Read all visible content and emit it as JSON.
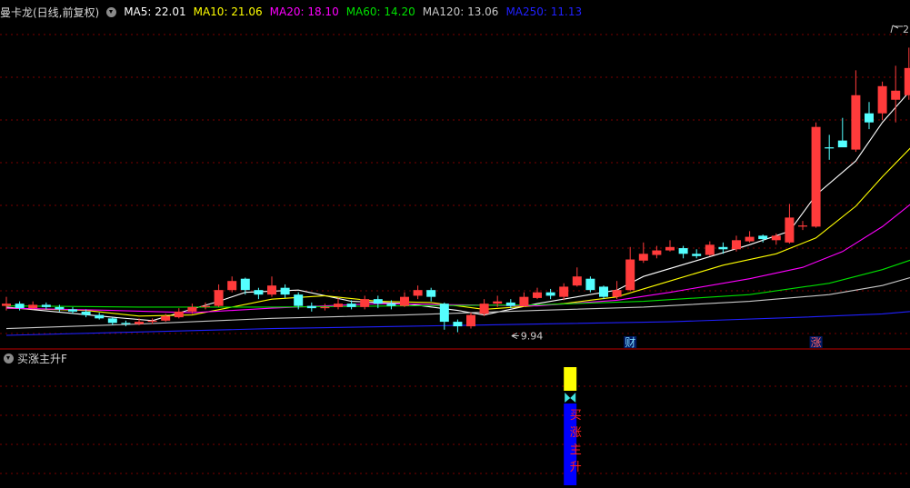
{
  "header": {
    "title": "曼卡龙(日线,前复权)",
    "ma_items": [
      {
        "label": "MA5: 22.01",
        "color": "#ffffff"
      },
      {
        "label": "MA10: 21.06",
        "color": "#ffff00"
      },
      {
        "label": "MA20: 18.10",
        "color": "#ff00ff"
      },
      {
        "label": "MA60: 14.20",
        "color": "#00e000"
      },
      {
        "label": "MA120: 13.06",
        "color": "#c8c8c8"
      },
      {
        "label": "MA250: 11.13",
        "color": "#2020ff"
      }
    ]
  },
  "indicator": {
    "title": "买涨主升F",
    "signal_text": [
      "买",
      "涨",
      "主",
      "升"
    ]
  },
  "markers": {
    "low_label": "9.94",
    "high_label": "2",
    "event_cai": "财",
    "event_zhang": "涨"
  },
  "colors": {
    "up": "#ff3b3b",
    "down": "#54ffff",
    "grid": "#7a0000",
    "signal_yellow": "#ffff00",
    "signal_blue": "#0000ff",
    "signal_text": "#ff2020"
  },
  "chart_data": {
    "type": "candlestick",
    "y_range": [
      9.2,
      23.8
    ],
    "low_marker_candle": 38,
    "candles": [
      [
        11.1,
        11.2,
        11.5,
        10.9
      ],
      [
        11.2,
        11.0,
        11.3,
        10.9
      ],
      [
        11.0,
        11.15,
        11.3,
        10.95
      ],
      [
        11.15,
        11.05,
        11.25,
        10.95
      ],
      [
        11.05,
        10.95,
        11.15,
        10.85
      ],
      [
        10.95,
        10.85,
        11.05,
        10.75
      ],
      [
        10.85,
        10.7,
        10.95,
        10.6
      ],
      [
        10.7,
        10.55,
        10.8,
        10.5
      ],
      [
        10.55,
        10.35,
        10.6,
        10.25
      ],
      [
        10.35,
        10.3,
        10.45,
        10.2
      ],
      [
        10.3,
        10.4,
        10.55,
        10.25
      ],
      [
        10.4,
        10.45,
        10.55,
        10.3
      ],
      [
        10.45,
        10.65,
        10.75,
        10.4
      ],
      [
        10.6,
        10.85,
        11.0,
        10.55
      ],
      [
        10.85,
        11.05,
        11.2,
        10.75
      ],
      [
        11.05,
        11.1,
        11.25,
        10.95
      ],
      [
        11.1,
        11.8,
        12.05,
        11.05
      ],
      [
        11.8,
        12.2,
        12.4,
        11.7
      ],
      [
        12.3,
        11.8,
        12.35,
        11.6
      ],
      [
        11.8,
        11.6,
        11.9,
        11.4
      ],
      [
        11.6,
        12.0,
        12.4,
        11.5
      ],
      [
        11.9,
        11.6,
        12.05,
        11.45
      ],
      [
        11.6,
        11.1,
        11.7,
        10.95
      ],
      [
        11.1,
        11.0,
        11.25,
        10.85
      ],
      [
        11.0,
        11.05,
        11.2,
        10.9
      ],
      [
        11.05,
        11.2,
        11.45,
        10.95
      ],
      [
        11.2,
        11.05,
        11.35,
        10.95
      ],
      [
        11.05,
        11.4,
        11.55,
        10.95
      ],
      [
        11.4,
        11.2,
        11.55,
        11.0
      ],
      [
        11.2,
        11.1,
        11.35,
        10.95
      ],
      [
        11.1,
        11.5,
        11.7,
        11.05
      ],
      [
        11.55,
        11.8,
        12.0,
        11.4
      ],
      [
        11.8,
        11.5,
        11.9,
        11.3
      ],
      [
        11.2,
        10.4,
        11.25,
        10.05
      ],
      [
        10.4,
        10.2,
        10.5,
        9.94
      ],
      [
        10.2,
        10.7,
        10.8,
        10.1
      ],
      [
        10.75,
        11.2,
        11.4,
        10.65
      ],
      [
        11.2,
        11.3,
        11.55,
        11.05
      ],
      [
        11.25,
        11.1,
        11.4,
        11.0
      ],
      [
        11.1,
        11.5,
        11.7,
        11.05
      ],
      [
        11.45,
        11.7,
        11.9,
        11.4
      ],
      [
        11.7,
        11.55,
        11.85,
        11.4
      ],
      [
        11.5,
        11.95,
        12.1,
        11.35
      ],
      [
        12.0,
        12.4,
        12.8,
        11.95
      ],
      [
        12.3,
        11.8,
        12.4,
        11.7
      ],
      [
        11.95,
        11.5,
        12.0,
        11.4
      ],
      [
        11.5,
        11.8,
        12.2,
        11.4
      ],
      [
        11.8,
        13.15,
        13.7,
        11.75
      ],
      [
        13.1,
        13.4,
        13.9,
        13.0
      ],
      [
        13.35,
        13.55,
        13.75,
        13.2
      ],
      [
        13.55,
        13.7,
        14.0,
        13.5
      ],
      [
        13.65,
        13.4,
        13.75,
        13.2
      ],
      [
        13.4,
        13.3,
        13.6,
        13.2
      ],
      [
        13.35,
        13.8,
        13.95,
        13.3
      ],
      [
        13.7,
        13.6,
        13.9,
        13.4
      ],
      [
        13.6,
        14.0,
        14.2,
        13.5
      ],
      [
        13.95,
        14.15,
        14.4,
        13.9
      ],
      [
        14.2,
        14.05,
        14.25,
        13.9
      ],
      [
        14.0,
        14.2,
        14.3,
        13.8
      ],
      [
        13.9,
        15.0,
        15.6,
        13.85
      ],
      [
        14.6,
        14.65,
        14.85,
        14.45
      ],
      [
        14.6,
        19.0,
        19.2,
        14.55
      ],
      [
        18.1,
        18.05,
        18.65,
        17.55
      ],
      [
        18.4,
        18.1,
        19.4,
        18.2
      ],
      [
        18.0,
        20.4,
        21.5,
        17.9
      ],
      [
        19.6,
        19.2,
        20.1,
        18.9
      ],
      [
        19.6,
        20.8,
        21.0,
        19.3
      ],
      [
        20.2,
        20.6,
        21.7,
        19.2
      ],
      [
        20.4,
        21.6,
        22.5,
        20.2
      ],
      [
        21.0,
        21.1,
        22.1,
        20.5
      ]
    ],
    "ma_series": [
      {
        "label": "MA5",
        "color": "#ffffff",
        "points": [
          [
            0,
            11.05
          ],
          [
            8,
            10.6
          ],
          [
            11,
            10.45
          ],
          [
            16,
            11.3
          ],
          [
            18,
            11.7
          ],
          [
            22,
            11.8
          ],
          [
            26,
            11.3
          ],
          [
            30,
            11.2
          ],
          [
            34,
            10.9
          ],
          [
            36,
            10.7
          ],
          [
            40,
            11.2
          ],
          [
            46,
            11.8
          ],
          [
            48,
            12.4
          ],
          [
            52,
            13.1
          ],
          [
            56,
            13.8
          ],
          [
            59,
            14.4
          ],
          [
            61,
            16.0
          ],
          [
            64,
            17.5
          ],
          [
            66,
            19.2
          ],
          [
            69,
            21.2
          ]
        ]
      },
      {
        "label": "MA10",
        "color": "#ffff00",
        "points": [
          [
            0,
            11.0
          ],
          [
            6,
            10.9
          ],
          [
            10,
            10.65
          ],
          [
            14,
            10.7
          ],
          [
            20,
            11.4
          ],
          [
            24,
            11.55
          ],
          [
            28,
            11.3
          ],
          [
            32,
            11.25
          ],
          [
            36,
            10.95
          ],
          [
            42,
            11.2
          ],
          [
            46,
            11.5
          ],
          [
            50,
            12.2
          ],
          [
            54,
            12.9
          ],
          [
            58,
            13.4
          ],
          [
            61,
            14.1
          ],
          [
            64,
            15.5
          ],
          [
            66,
            16.8
          ],
          [
            69,
            18.6
          ]
        ]
      },
      {
        "label": "MA20",
        "color": "#ff00ff",
        "points": [
          [
            0,
            11.0
          ],
          [
            8,
            10.9
          ],
          [
            14,
            10.8
          ],
          [
            20,
            11.0
          ],
          [
            28,
            11.2
          ],
          [
            34,
            11.15
          ],
          [
            40,
            11.1
          ],
          [
            46,
            11.35
          ],
          [
            50,
            11.7
          ],
          [
            56,
            12.3
          ],
          [
            60,
            12.8
          ],
          [
            63,
            13.5
          ],
          [
            66,
            14.6
          ],
          [
            69,
            16.0
          ]
        ]
      },
      {
        "label": "MA60",
        "color": "#00e000",
        "points": [
          [
            0,
            11.1
          ],
          [
            10,
            11.05
          ],
          [
            20,
            11.05
          ],
          [
            30,
            11.1
          ],
          [
            40,
            11.15
          ],
          [
            48,
            11.3
          ],
          [
            56,
            11.6
          ],
          [
            62,
            12.1
          ],
          [
            66,
            12.7
          ],
          [
            69,
            13.3
          ]
        ]
      },
      {
        "label": "MA120",
        "color": "#c8c8c8",
        "points": [
          [
            0,
            10.1
          ],
          [
            10,
            10.3
          ],
          [
            20,
            10.55
          ],
          [
            30,
            10.7
          ],
          [
            40,
            10.9
          ],
          [
            48,
            11.05
          ],
          [
            56,
            11.3
          ],
          [
            62,
            11.6
          ],
          [
            66,
            12.0
          ],
          [
            69,
            12.5
          ]
        ]
      },
      {
        "label": "MA250",
        "color": "#2020ff",
        "points": [
          [
            0,
            9.8
          ],
          [
            10,
            9.95
          ],
          [
            20,
            10.1
          ],
          [
            30,
            10.2
          ],
          [
            40,
            10.3
          ],
          [
            50,
            10.4
          ],
          [
            60,
            10.6
          ],
          [
            66,
            10.75
          ],
          [
            69,
            10.9
          ]
        ]
      }
    ],
    "event_markers": [
      {
        "candle": 47,
        "label": "财"
      },
      {
        "candle": 61,
        "label": "涨"
      }
    ],
    "signal_candle": 42
  }
}
